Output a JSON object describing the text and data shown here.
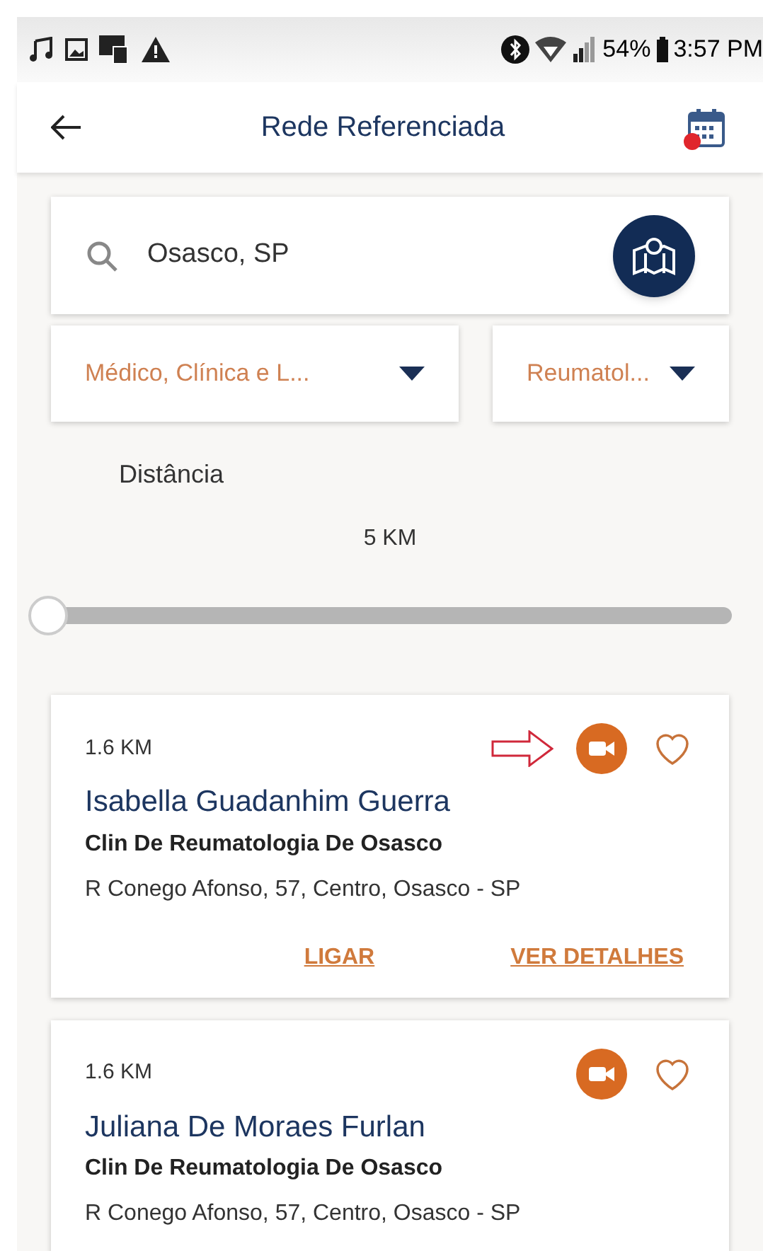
{
  "status_bar": {
    "battery": "54%",
    "time": "3:57 PM"
  },
  "header": {
    "title": "Rede Referenciada",
    "calendar_badge": true
  },
  "search": {
    "value": "Osasco, SP"
  },
  "filters": [
    {
      "value": "Médico, Clínica e L..."
    },
    {
      "value": "Reumatol..."
    }
  ],
  "distance": {
    "label": "Distância",
    "reading": "5 KM",
    "level": 0
  },
  "results": [
    {
      "distance": "1.6 KM",
      "name": "Isabella Guadanhim Guerra",
      "clinic": "Clin De Reumatologia De Osasco",
      "address": "R Conego Afonso, 57, Centro, Osasco - SP",
      "pointer_arrow": true,
      "favorite": false,
      "actions": [
        "LIGAR",
        "VER DETALHES"
      ]
    },
    {
      "distance": "1.6 KM",
      "name": "Juliana De Moraes Furlan",
      "clinic": "Clin De Reumatologia De Osasco",
      "address": "R Conego Afonso, 57, Centro, Osasco - SP",
      "pointer_arrow": false,
      "favorite": false
    }
  ]
}
